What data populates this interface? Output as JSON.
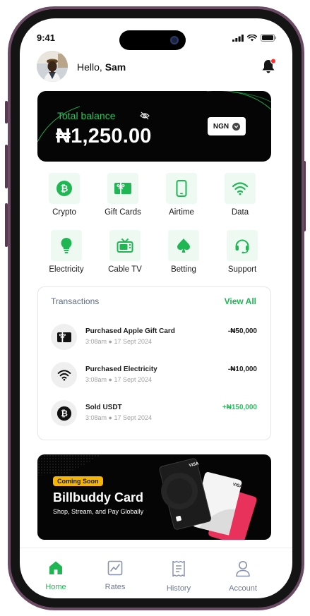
{
  "status_bar": {
    "time": "9:41"
  },
  "header": {
    "greeting": "Hello,",
    "user_name": "Sam"
  },
  "balance": {
    "label": "Total balance",
    "amount": "₦1,250.00",
    "currency": "NGN"
  },
  "services": [
    {
      "label": "Crypto",
      "icon": "bitcoin-icon"
    },
    {
      "label": "Gift Cards",
      "icon": "gift-card-icon"
    },
    {
      "label": "Airtime",
      "icon": "phone-icon"
    },
    {
      "label": "Data",
      "icon": "wifi-icon"
    },
    {
      "label": "Electricity",
      "icon": "bulb-icon"
    },
    {
      "label": "Cable TV",
      "icon": "tv-icon"
    },
    {
      "label": "Betting",
      "icon": "spade-icon"
    },
    {
      "label": "Support",
      "icon": "headset-icon"
    }
  ],
  "transactions": {
    "title": "Transactions",
    "view_all": "View All",
    "items": [
      {
        "title": "Purchased Apple Gift Card",
        "time": "3:08am",
        "date": "17 Sept 2024",
        "amount": "-₦50,000",
        "icon": "gift-card-icon"
      },
      {
        "title": "Purchased Electricity",
        "time": "3:08am",
        "date": "17 Sept 2024",
        "amount": "-₦10,000",
        "icon": "wifi-icon"
      },
      {
        "title": "Sold USDT",
        "time": "3:08am",
        "date": "17 Sept 2024",
        "amount": "+₦150,000",
        "icon": "bitcoin-icon"
      }
    ]
  },
  "promo": {
    "badge": "Coming Soon",
    "title": "Billbuddy Card",
    "subtitle": "Shop, Stream, and Pay Globally",
    "card_brand": "VISA"
  },
  "bottom_nav": [
    {
      "label": "Home",
      "icon": "home-icon",
      "active": true
    },
    {
      "label": "Rates",
      "icon": "chart-icon",
      "active": false
    },
    {
      "label": "History",
      "icon": "receipt-icon",
      "active": false
    },
    {
      "label": "Account",
      "icon": "user-icon",
      "active": false
    }
  ],
  "colors": {
    "accent": "#22c55e",
    "accent_dark": "#1fb653",
    "tile_bg": "#eefaf1",
    "card_bg": "#050505",
    "badge": "#f6b500",
    "notification_dot": "#ff2d2d",
    "frame": "#6b4a63"
  }
}
